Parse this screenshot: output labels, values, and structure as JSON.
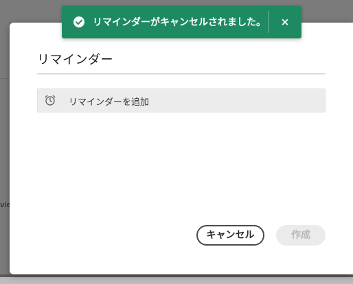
{
  "toast": {
    "message": "リマインダーがキャンセルされました。",
    "close_symbol": "×",
    "color": "#1e8a62"
  },
  "dialog": {
    "title": "リマインダー",
    "add_reminder_label": "リマインダーを追加",
    "cancel_label": "キャンセル",
    "create_label": "作成"
  },
  "background": {
    "truncated_text": "view"
  },
  "icons": {
    "toast_check": "check-circle-icon",
    "alarm": "alarm-clock-icon",
    "close": "close-icon"
  }
}
